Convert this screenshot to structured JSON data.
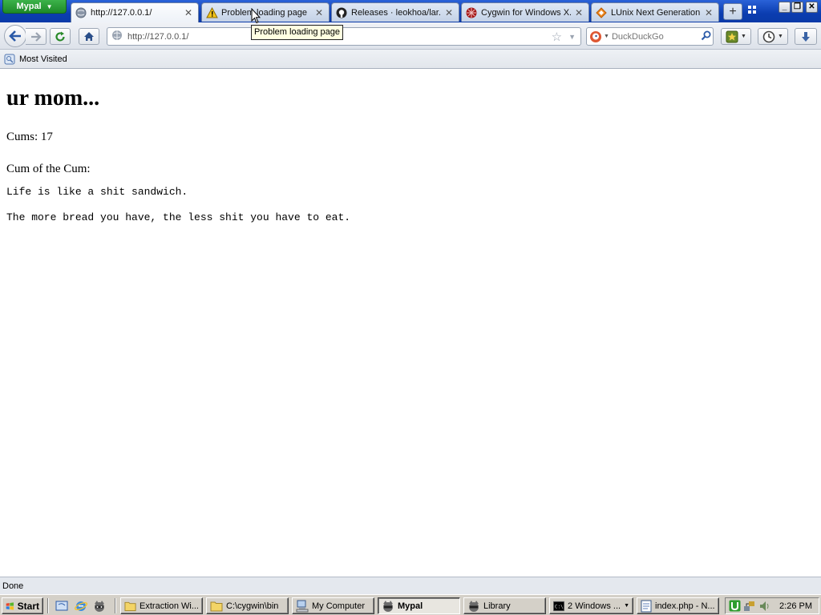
{
  "browser": {
    "app_menu_label": "Mypal",
    "tabs": [
      {
        "title": "http://127.0.0.1/",
        "icon": "globe-icon",
        "active": true
      },
      {
        "title": "Problem loading page",
        "icon": "warning-icon",
        "active": false
      },
      {
        "title": "Releases · leokhoa/lar...",
        "icon": "github-icon",
        "active": false
      },
      {
        "title": "Cygwin for Windows X...",
        "icon": "cygwin-icon",
        "active": false
      },
      {
        "title": "LUnix Next Generation...",
        "icon": "diamond-icon",
        "active": false
      }
    ],
    "new_tab_label": "+",
    "url": "http://127.0.0.1/",
    "search_placeholder": "DuckDuckGo",
    "tooltip": "Problem loading page",
    "bookmarks_bar": {
      "most_visited_label": "Most Visited"
    },
    "status_text": "Done"
  },
  "page": {
    "heading": "ur mom...",
    "count_line": "Cums: 17",
    "section_label": "Cum of the Cum:",
    "quote_lines": [
      "Life is like a shit sandwich.",
      "The more bread you have, the less shit you have to eat."
    ]
  },
  "taskbar": {
    "start_label": "Start",
    "tasks": [
      {
        "label": "Extraction Wi...",
        "icon": "folder-icon"
      },
      {
        "label": "C:\\cygwin\\bin",
        "icon": "folder-icon"
      },
      {
        "label": "My Computer",
        "icon": "computer-icon"
      },
      {
        "label": "Mypal",
        "icon": "mypal-icon",
        "active": true
      },
      {
        "label": "Library",
        "icon": "mypal-icon"
      },
      {
        "label": "2 Windows ...",
        "icon": "console-icon"
      },
      {
        "label": "index.php - N...",
        "icon": "notepad-icon"
      }
    ],
    "clock": "2:26 PM"
  },
  "colors": {
    "titlebar_blue": "#0b3db0",
    "app_menu_green": "#1d8a28",
    "taskbar_gray": "#d4d0c8",
    "tooltip_yellow": "#ffffe1"
  }
}
